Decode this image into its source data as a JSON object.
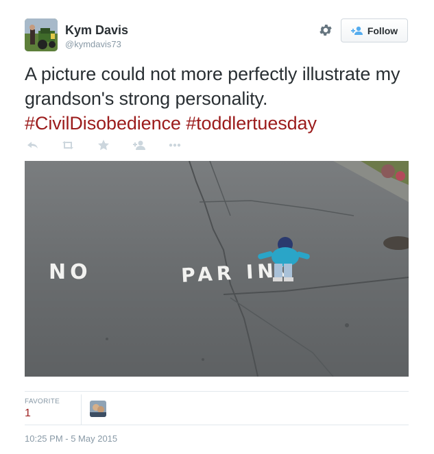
{
  "user": {
    "name": "Kym Davis",
    "handle": "@kymdavis73"
  },
  "header": {
    "follow_label": "Follow",
    "settings_icon": "gear-icon",
    "follow_icon": "follow-person-plus-icon"
  },
  "tweet": {
    "text_line": "A picture could not more perfectly illustrate my grandson's strong personality.",
    "hashtags": [
      "#CivilDisobedience",
      "#toddlertuesday"
    ]
  },
  "actions": {
    "icons": [
      "reply-icon",
      "retweet-icon",
      "favorite-star-icon",
      "follow-person-icon",
      "more-ellipsis-icon"
    ]
  },
  "photo": {
    "road_text_left": "NO",
    "road_text_right": "PAR ING"
  },
  "stats": {
    "favorite_label": "FAVORITE",
    "favorite_count": "1"
  },
  "timestamp": "10:25 PM - 5 May 2015",
  "colors": {
    "hashtag": "#9b1b1b",
    "text": "#292f33",
    "muted": "#8899a6",
    "border": "#e1e8ed"
  }
}
